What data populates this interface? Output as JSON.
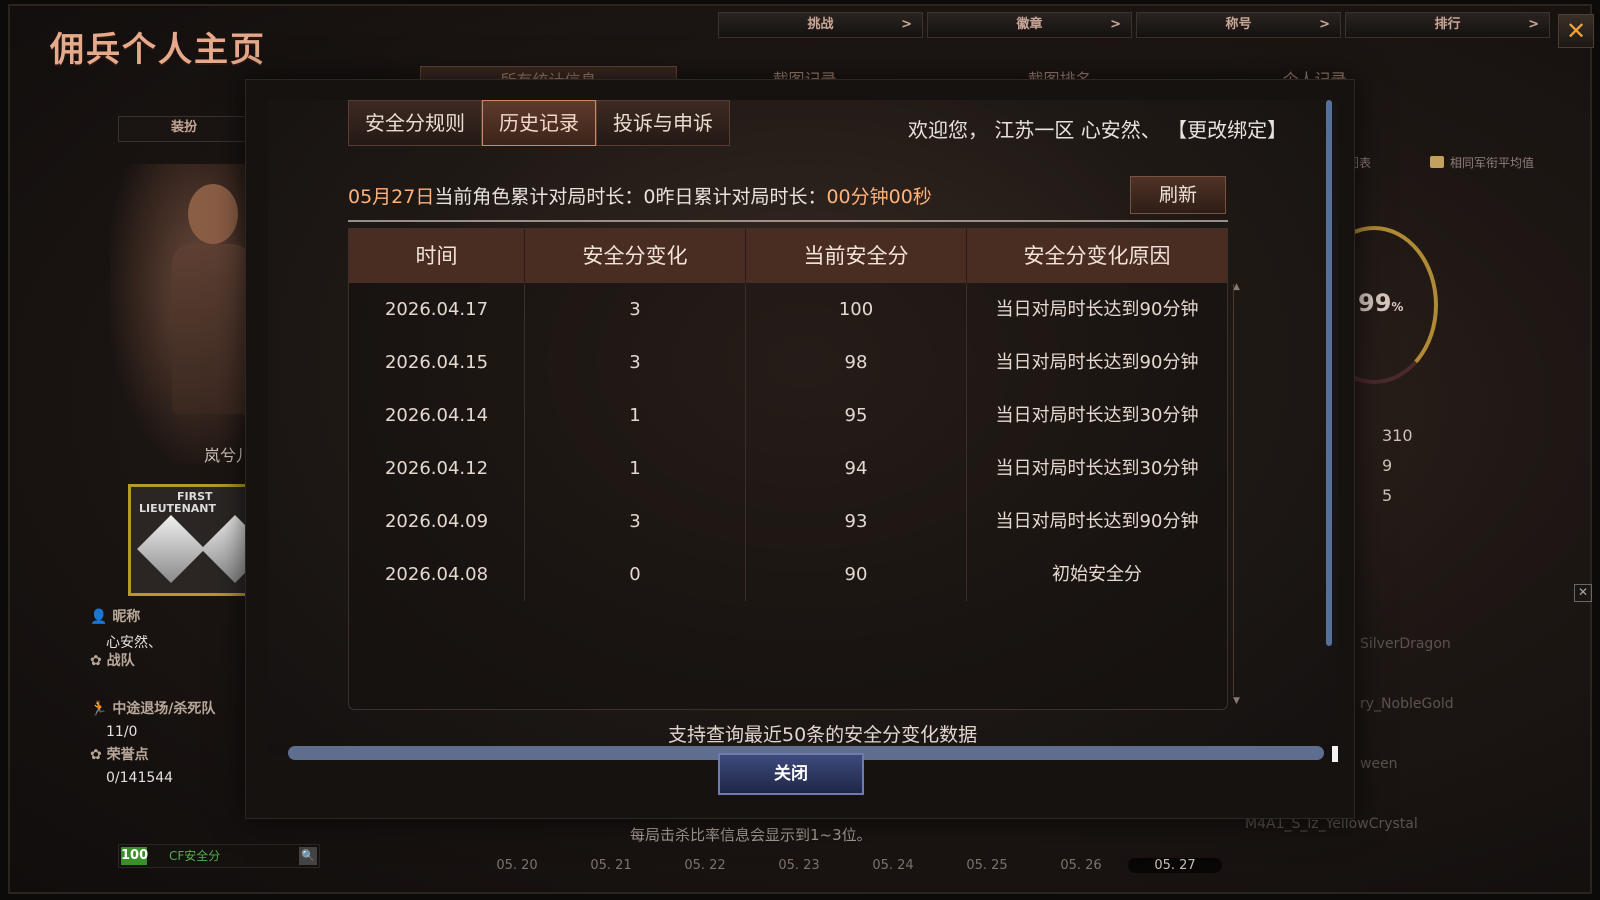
{
  "page_title": "佣兵个人主页",
  "top_tabs": [
    {
      "label": "挑战"
    },
    {
      "label": "徽章"
    },
    {
      "label": "称号"
    },
    {
      "label": "排行"
    }
  ],
  "top_tab_arrow": ">",
  "close_glyph": "✕",
  "bg_tabs": [
    "所有统计信息",
    "截图记录",
    "截图排名",
    "个人记录"
  ],
  "left_panel": {
    "dress_button": "装扮",
    "character_name": "岚兮儿",
    "rank_text_line1": "FIRST",
    "rank_text_line2": "LIEUTENANT",
    "nickname_label": "昵称",
    "nickname_value": "心安然、",
    "team_label": "战队",
    "quit_label": "中途退场/杀死队",
    "quit_value": "11/0",
    "honor_label": "荣誉点",
    "honor_value": "0/141544",
    "safety_score": "100",
    "safety_label": "CF安全分",
    "search_icon": "search-icon"
  },
  "dates": [
    "05. 20",
    "05. 21",
    "05. 22",
    "05. 23",
    "05. 24",
    "05. 25",
    "05. 26",
    "05. 27"
  ],
  "active_date": "05. 27",
  "bg_note": "每局击杀比率信息会显示到1~3位。",
  "right_panel": {
    "legend_1": "的图表",
    "legend_2": "相同军衔平均值",
    "percent": "99",
    "percent_unit": "%",
    "stats": [
      "310",
      "9",
      "5"
    ],
    "players": [
      "SilverDragon",
      "ry_NobleGold",
      "ween",
      "M4A1_S_lz_YellowCrystal"
    ]
  },
  "modal": {
    "tabs": [
      {
        "label": "安全分规则",
        "active": false
      },
      {
        "label": "历史记录",
        "active": true
      },
      {
        "label": "投诉与申诉",
        "active": false
      }
    ],
    "welcome": "欢迎您， 江苏一区 心安然、 【更改绑定】",
    "info_date": "05月27日",
    "info_mid": "当前角色累计对局时长：0昨日累计对局时长：",
    "info_time": "00分钟00秒",
    "refresh_label": "刷新",
    "table": {
      "headers": [
        "时间",
        "安全分变化",
        "当前安全分",
        "安全分变化原因"
      ],
      "rows": [
        [
          "2026.04.17",
          "3",
          "100",
          "当日对局时长达到90分钟"
        ],
        [
          "2026.04.15",
          "3",
          "98",
          "当日对局时长达到90分钟"
        ],
        [
          "2026.04.14",
          "1",
          "95",
          "当日对局时长达到30分钟"
        ],
        [
          "2026.04.12",
          "1",
          "94",
          "当日对局时长达到30分钟"
        ],
        [
          "2026.04.09",
          "3",
          "93",
          "当日对局时长达到90分钟"
        ],
        [
          "2026.04.08",
          "0",
          "90",
          "初始安全分"
        ]
      ]
    },
    "footnote": "支持查询最近50条的安全分变化数据",
    "close_label": "关闭"
  },
  "colors": {
    "accent_orange": "#ffb27a",
    "header_bg": "#4a2d22",
    "close_btn": "#3d4a7c",
    "safety_green": "#3b8f2b"
  }
}
